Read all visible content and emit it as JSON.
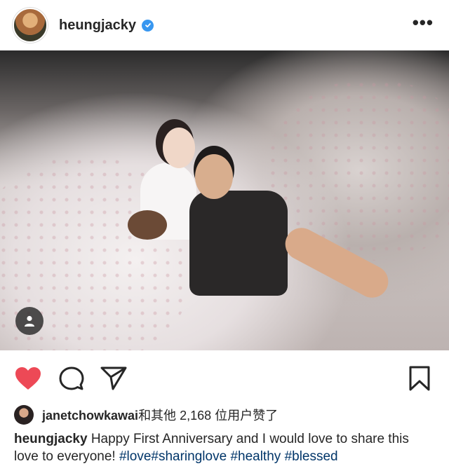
{
  "header": {
    "username": "heungjacky",
    "verified": true,
    "more_label": "•••",
    "icons": {
      "avatar": "profile-avatar",
      "verified": "verified-check-icon",
      "more": "more-dots-icon"
    }
  },
  "post": {
    "photo_alt": "photo",
    "user_tag_icon": "user-tag-icon"
  },
  "actions": {
    "like_icon": "heart-filled-icon",
    "like_color": "#ed4956",
    "comment_icon": "comment-icon",
    "share_icon": "share-icon",
    "save_icon": "bookmark-icon"
  },
  "likes": {
    "liker": "janetchowkawai",
    "suffix": "和其他 2,168 位用户赞了"
  },
  "caption": {
    "username": "heungjacky",
    "text": "Happy First Anniversary and I would love to share this love to everyone!",
    "hashtags": [
      "#love",
      "#sharinglove",
      "#healthy",
      "#blessed"
    ]
  }
}
